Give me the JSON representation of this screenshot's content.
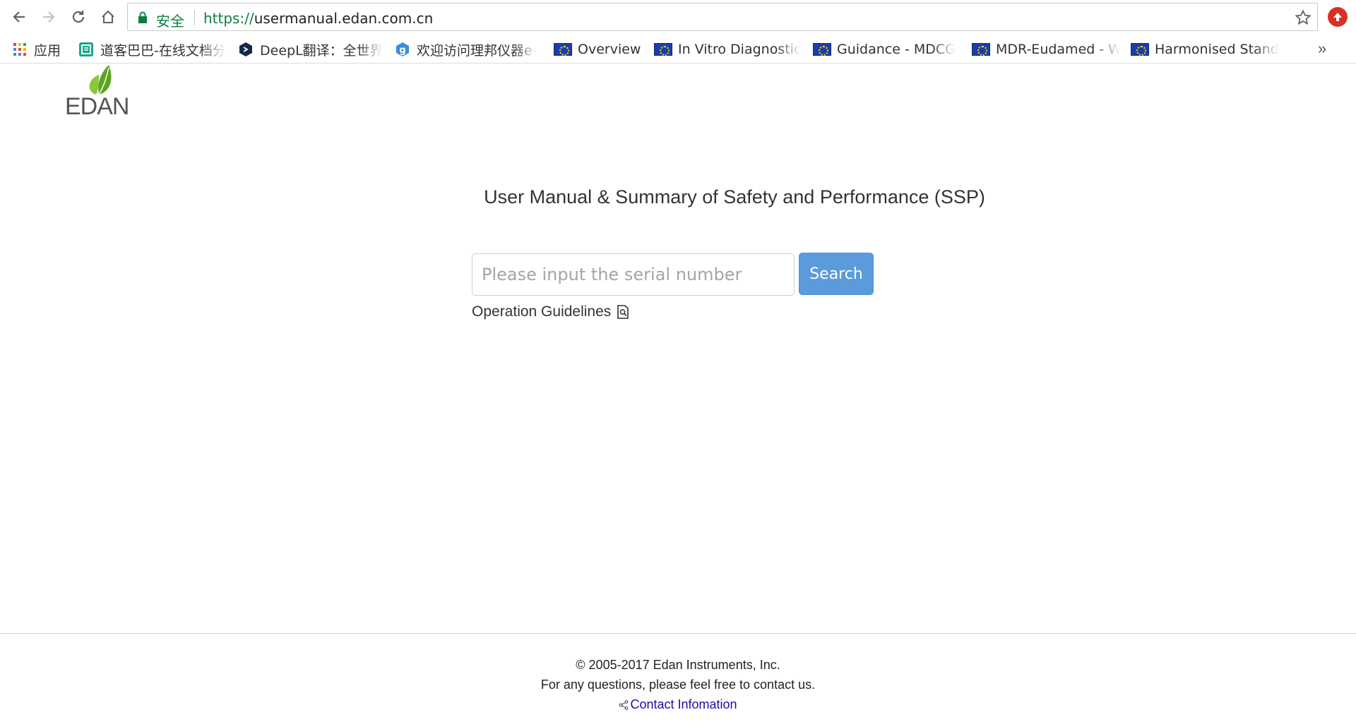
{
  "browser": {
    "secure_label": "安全",
    "url_scheme": "https://",
    "url_rest": "usermanual.edan.com.cn",
    "bookmarks": [
      {
        "label": "应用",
        "icon": "apps-grid-icon"
      },
      {
        "label": "道客巴巴-在线文档分",
        "icon": "doc88-icon"
      },
      {
        "label": "DeepL翻译：全世界",
        "icon": "deepl-icon"
      },
      {
        "label": "欢迎访问理邦仪器e-",
        "icon": "g-icon"
      },
      {
        "label": "Overview",
        "icon": "eu-flag-icon"
      },
      {
        "label": "In Vitro Diagnostic",
        "icon": "eu-flag-icon"
      },
      {
        "label": "Guidance - MDCG",
        "icon": "eu-flag-icon"
      },
      {
        "label": "MDR-Eudamed - W",
        "icon": "eu-flag-icon"
      },
      {
        "label": "Harmonised Stand",
        "icon": "eu-flag-icon"
      }
    ],
    "overflow": "»"
  },
  "logo": {
    "text": "EDAN"
  },
  "main": {
    "title": "User Manual & Summary of Safety and Performance (SSP)",
    "search_placeholder": "Please input the serial number",
    "search_button": "Search",
    "guidelines_label": "Operation Guidelines"
  },
  "footer": {
    "copyright": "© 2005-2017 Edan Instruments, Inc.",
    "questions": "For any questions, please feel free to contact us.",
    "contact_link": "Contact Infomation"
  },
  "colors": {
    "secure_green": "#0b8043",
    "button_blue": "#5b9bdc",
    "link_blue": "#1a0dab",
    "logo_green": "#7cb518"
  }
}
